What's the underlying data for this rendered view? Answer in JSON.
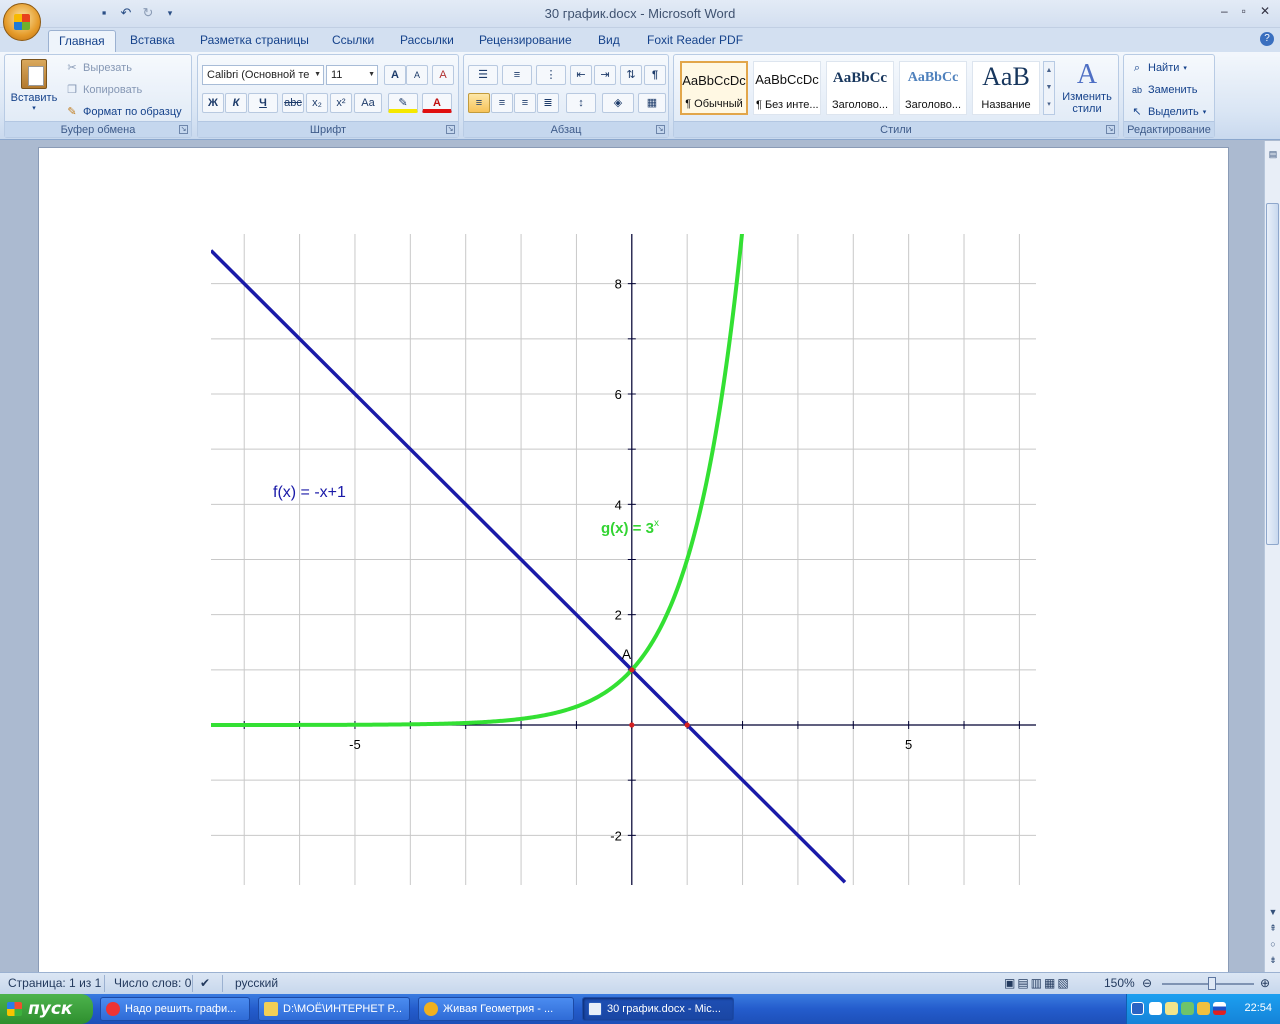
{
  "window": {
    "title": "30 график.docx - Microsoft Word",
    "controls": [
      "‒",
      "▫",
      "✕"
    ]
  },
  "tabs": [
    "Главная",
    "Вставка",
    "Разметка страницы",
    "Ссылки",
    "Рассылки",
    "Рецензирование",
    "Вид",
    "Foxit Reader PDF"
  ],
  "ribbon": {
    "clipboard": {
      "paste": "Вставить",
      "cut": "Вырезать",
      "copy": "Копировать",
      "format_painter": "Формат по образцу",
      "label": "Буфер обмена"
    },
    "font": {
      "font_name": "Calibri (Основной те",
      "font_size": "11",
      "label": "Шрифт",
      "bold": "Ж",
      "italic": "К",
      "underline": "Ч",
      "strike": "abc",
      "sub": "x₂",
      "sup": "x²",
      "case": "Aa",
      "grow": "A",
      "shrink": "A",
      "clear": "A"
    },
    "paragraph": {
      "label": "Абзац",
      "pilcrow": "¶"
    },
    "styles": {
      "label": "Стили",
      "items": [
        {
          "preview": "AaBbCcDc",
          "name": "¶ Обычный"
        },
        {
          "preview": "AaBbCcDc",
          "name": "¶ Без инте..."
        },
        {
          "preview": "AaBbCc",
          "name": "Заголово..."
        },
        {
          "preview": "AaBbCc",
          "name": "Заголово..."
        },
        {
          "preview": "AaB",
          "name": "Название"
        }
      ],
      "change": "Изменить\nстили"
    },
    "editing": {
      "label": "Редактирование",
      "find": "Найти",
      "replace": "Заменить",
      "select": "Выделить"
    }
  },
  "graph": {
    "f_label": "f(x) = -x+1",
    "g_label": "g(x) = 3",
    "g_sup": "x",
    "point_label": "A",
    "x_ticks": [
      "-5",
      "5"
    ],
    "y_ticks": [
      "8",
      "6",
      "4",
      "2",
      "-2"
    ],
    "colors": {
      "f": "#1a1aa8",
      "g": "#33e033",
      "grid": "#c8c8c8",
      "axis": "#000033"
    }
  },
  "chart_data": {
    "type": "line",
    "title": "",
    "xlabel": "",
    "ylabel": "",
    "xlim": [
      -7.6,
      7.3
    ],
    "ylim": [
      -2.9,
      8.9
    ],
    "grid": true,
    "series": [
      {
        "name": "f(x) = -x+1",
        "formula": "-x+1",
        "x": [
          -7.6,
          3.85
        ],
        "y": [
          8.6,
          -2.85
        ]
      },
      {
        "name": "g(x) = 3^x",
        "formula": "3^x",
        "x": [
          -7.6,
          -4,
          -2,
          -1,
          0,
          1,
          1.5,
          1.99
        ],
        "y": [
          0.0002,
          0.012,
          0.111,
          0.333,
          1,
          3,
          5.196,
          8.9
        ]
      }
    ],
    "points": [
      {
        "label": "A",
        "x": 0,
        "y": 1
      },
      {
        "label": "",
        "x": 1,
        "y": 0
      },
      {
        "label": "",
        "x": 0,
        "y": 0
      }
    ]
  },
  "statusbar": {
    "page": "Страница: 1 из 1",
    "words": "Число слов: 0",
    "lang": "русский",
    "zoom": "150%"
  },
  "taskbar": {
    "start": "пуск",
    "tasks": [
      "Надо решить графи...",
      "D:\\МОЁ\\ИНТЕРНЕТ Р...",
      "Живая Геометрия - ...",
      "30 график.docx - Mic..."
    ],
    "clock": "22:54"
  }
}
